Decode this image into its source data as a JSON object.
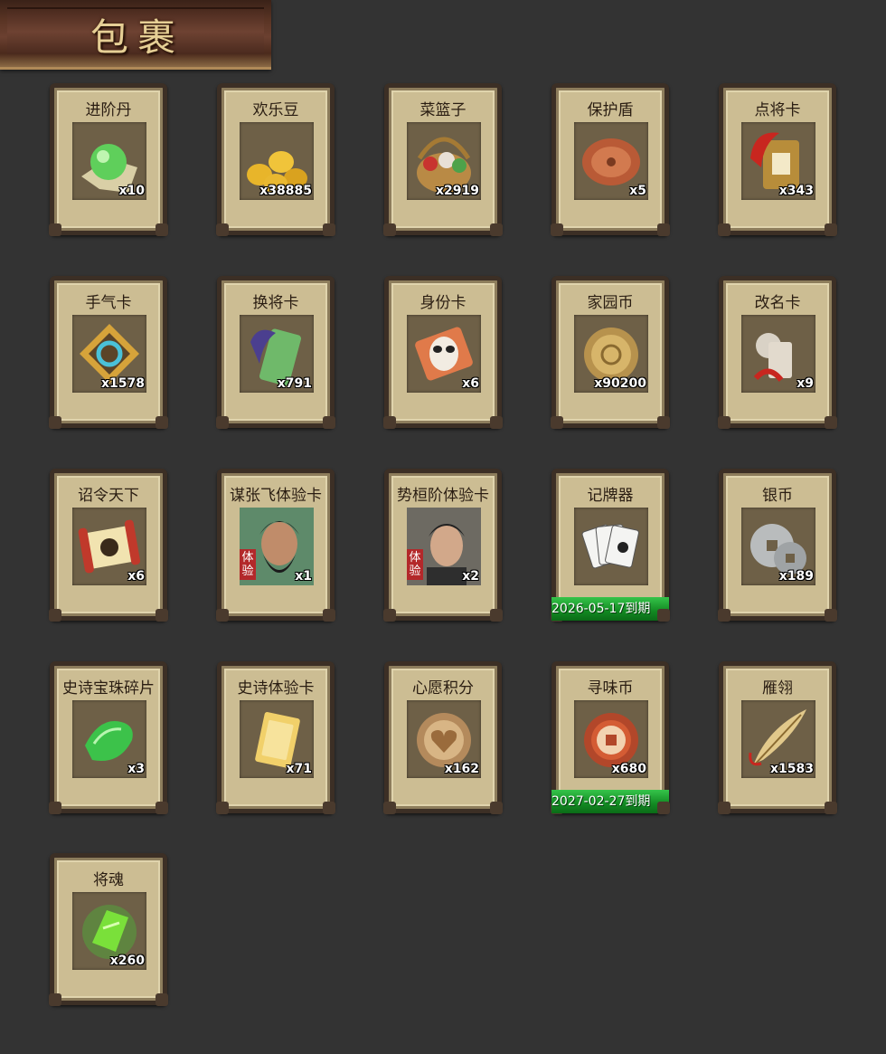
{
  "header": {
    "title": "包裹"
  },
  "items": [
    {
      "name": "进阶丹",
      "count": "x10",
      "icon": "green-pill-icon"
    },
    {
      "name": "欢乐豆",
      "count": "x38885",
      "icon": "gold-beans-icon"
    },
    {
      "name": "菜篮子",
      "count": "x2919",
      "icon": "vegetable-basket-icon"
    },
    {
      "name": "保护盾",
      "count": "x5",
      "icon": "round-shield-icon"
    },
    {
      "name": "点将卡",
      "count": "x343",
      "icon": "general-card-icon"
    },
    {
      "name": "手气卡",
      "count": "x1578",
      "icon": "luck-card-icon"
    },
    {
      "name": "换将卡",
      "count": "x791",
      "icon": "swap-general-card-icon"
    },
    {
      "name": "身份卡",
      "count": "x6",
      "icon": "identity-mask-card-icon"
    },
    {
      "name": "家园币",
      "count": "x90200",
      "icon": "home-coin-icon"
    },
    {
      "name": "改名卡",
      "count": "x9",
      "icon": "rename-card-icon"
    },
    {
      "name": "诏令天下",
      "count": "x6",
      "icon": "imperial-edict-scroll-icon"
    },
    {
      "name": "谋张飞体验卡",
      "count": "x1",
      "icon": "zhangfei-portrait-icon",
      "tag": "体验"
    },
    {
      "name": "势桓阶体验卡",
      "count": "x2",
      "icon": "huanjie-portrait-icon",
      "tag": "体验"
    },
    {
      "name": "记牌器",
      "count": "",
      "icon": "playing-cards-icon",
      "expiry": "2026-05-17到期"
    },
    {
      "name": "银币",
      "count": "x189",
      "icon": "silver-coins-icon"
    },
    {
      "name": "史诗宝珠碎片",
      "count": "x3",
      "icon": "green-gem-shard-icon"
    },
    {
      "name": "史诗体验卡",
      "count": "x71",
      "icon": "gold-card-icon"
    },
    {
      "name": "心愿积分",
      "count": "x162",
      "icon": "heart-coin-icon"
    },
    {
      "name": "寻味币",
      "count": "x680",
      "icon": "flavor-coin-icon",
      "expiry": "2027-02-27到期"
    },
    {
      "name": "雁翎",
      "count": "x1583",
      "icon": "feather-icon"
    },
    {
      "name": "将魂",
      "count": "x260",
      "icon": "green-soul-crystal-icon"
    }
  ],
  "colors": {
    "background": "#333333",
    "card": "#ccbd93",
    "expiry": "#128a22",
    "text": "#2a1d12"
  }
}
